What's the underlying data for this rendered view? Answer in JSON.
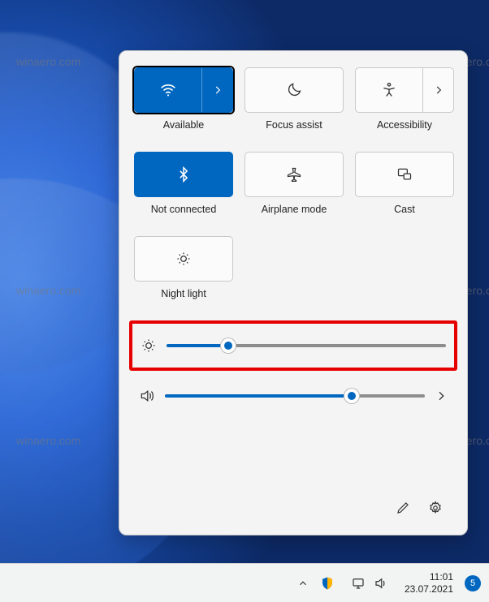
{
  "tiles": {
    "wifi": {
      "label": "Available",
      "active": true,
      "hasArrow": true
    },
    "focus_assist": {
      "label": "Focus assist",
      "active": false,
      "hasArrow": false
    },
    "accessibility": {
      "label": "Accessibility",
      "active": false,
      "hasArrow": true
    },
    "bluetooth": {
      "label": "Not connected",
      "active": true,
      "hasArrow": false
    },
    "airplane": {
      "label": "Airplane mode",
      "active": false,
      "hasArrow": false
    },
    "cast": {
      "label": "Cast",
      "active": false,
      "hasArrow": false
    },
    "night_light": {
      "label": "Night light",
      "active": false,
      "hasArrow": false
    }
  },
  "sliders": {
    "brightness": {
      "value": 22,
      "min": 0,
      "max": 100
    },
    "volume": {
      "value": 72,
      "min": 0,
      "max": 100
    }
  },
  "taskbar": {
    "time": "11:01",
    "date": "23.07.2021",
    "notification_count": "5"
  },
  "watermark_text": "winaero.com",
  "colors": {
    "accent": "#0067c0",
    "panel_bg": "#f4f4f4",
    "highlight": "#e60000"
  }
}
